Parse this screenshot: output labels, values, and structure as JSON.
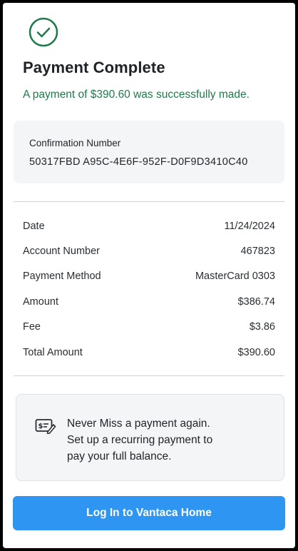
{
  "status": {
    "title": "Payment Complete",
    "message": "A payment of $390.60 was successfully made."
  },
  "confirmation": {
    "label": "Confirmation Number",
    "value": "50317FBD A95C-4E6F-952F-D0F9D3410C40"
  },
  "details": [
    {
      "label": "Date",
      "value": "11/24/2024"
    },
    {
      "label": "Account Number",
      "value": "467823"
    },
    {
      "label": "Payment Method",
      "value": "MasterCard 0303"
    },
    {
      "label": "Amount",
      "value": "$386.74"
    },
    {
      "label": "Fee",
      "value": "$3.86"
    },
    {
      "label": "Total Amount",
      "value": "$390.60"
    }
  ],
  "promo": {
    "lines": [
      "Never Miss a payment again.",
      "Set up a recurring payment to",
      "pay your full balance."
    ],
    "icon": "bill-edit-icon"
  },
  "login_button": {
    "label": "Log In to Vantaca Home"
  },
  "colors": {
    "success": "#1e7a4a",
    "accent": "#2f95f2",
    "card_bg": "#f4f5f6"
  }
}
